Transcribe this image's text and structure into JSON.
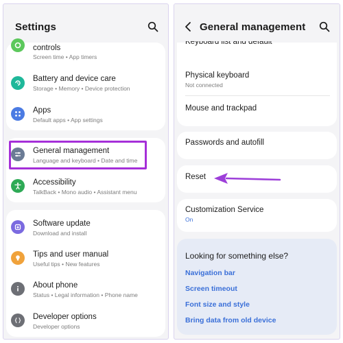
{
  "left": {
    "title": "Settings",
    "items": [
      {
        "label": "controls",
        "sub": "Screen time  •  App timers",
        "icon": "digital-wellbeing-icon",
        "color": "#5cc85c"
      },
      {
        "label": "Battery and device care",
        "sub": "Storage  •  Memory  •  Device protection",
        "icon": "device-care-icon",
        "color": "#1fb89a"
      },
      {
        "label": "Apps",
        "sub": "Default apps  •  App settings",
        "icon": "apps-icon",
        "color": "#4b7be3"
      },
      {
        "label": "General management",
        "sub": "Language and keyboard  •  Date and time",
        "icon": "sliders-icon",
        "color": "#6b7b95"
      },
      {
        "label": "Accessibility",
        "sub": "TalkBack  •  Mono audio  •  Assistant menu",
        "icon": "accessibility-icon",
        "color": "#2eaa56"
      },
      {
        "label": "Software update",
        "sub": "Download and install",
        "icon": "software-update-icon",
        "color": "#7b6ae0"
      },
      {
        "label": "Tips and user manual",
        "sub": "Useful tips  •  New features",
        "icon": "lightbulb-icon",
        "color": "#f0a23b"
      },
      {
        "label": "About phone",
        "sub": "Status  •  Legal information  •  Phone name",
        "icon": "info-icon",
        "color": "#6d6f75"
      },
      {
        "label": "Developer options",
        "sub": "Developer options",
        "icon": "braces-icon",
        "color": "#6d6f75"
      }
    ]
  },
  "right": {
    "title": "General management",
    "partial_item": "Keyboard list and default",
    "items": [
      {
        "label": "Physical keyboard",
        "sub": "Not connected"
      },
      {
        "label": "Mouse and trackpad",
        "sub": ""
      },
      {
        "label": "Passwords and autofill",
        "sub": ""
      },
      {
        "label": "Reset",
        "sub": ""
      },
      {
        "label": "Customization Service",
        "sub": "On"
      }
    ],
    "looking": {
      "title": "Looking for something else?",
      "links": [
        "Navigation bar",
        "Screen timeout",
        "Font size and style",
        "Bring data from old device"
      ]
    }
  },
  "colors": {
    "highlight": "#a52fd8",
    "link": "#3a6fd8",
    "arrow": "#9d3fd9"
  }
}
